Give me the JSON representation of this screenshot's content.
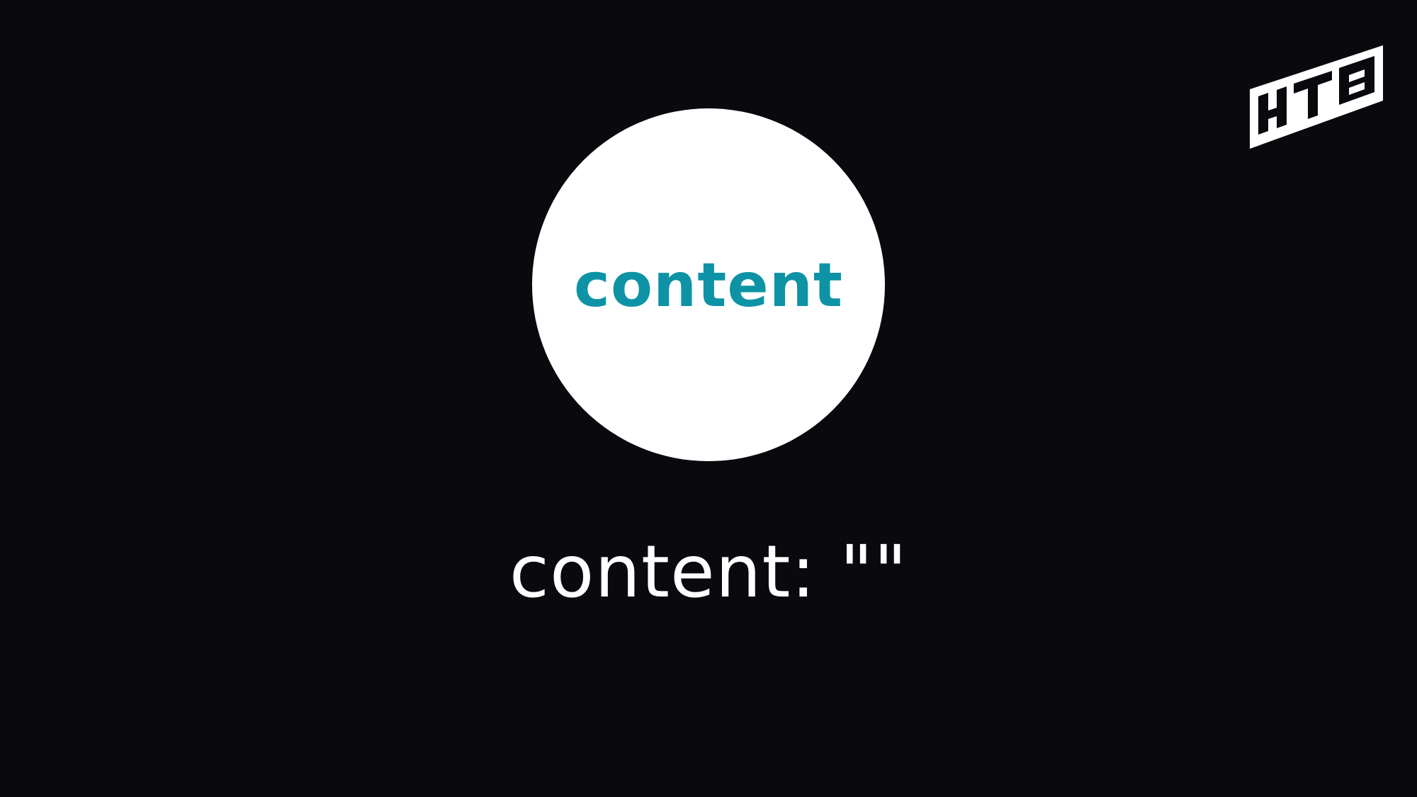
{
  "circle": {
    "label": "content",
    "background": "#ffffff",
    "label_color": "#0e93a6"
  },
  "code": {
    "text": "content: \"\""
  },
  "logo": {
    "text": "HTB",
    "icon": "brand-logo"
  },
  "colors": {
    "background": "#0a090e",
    "text": "#ffffff",
    "accent": "#0e93a6"
  }
}
